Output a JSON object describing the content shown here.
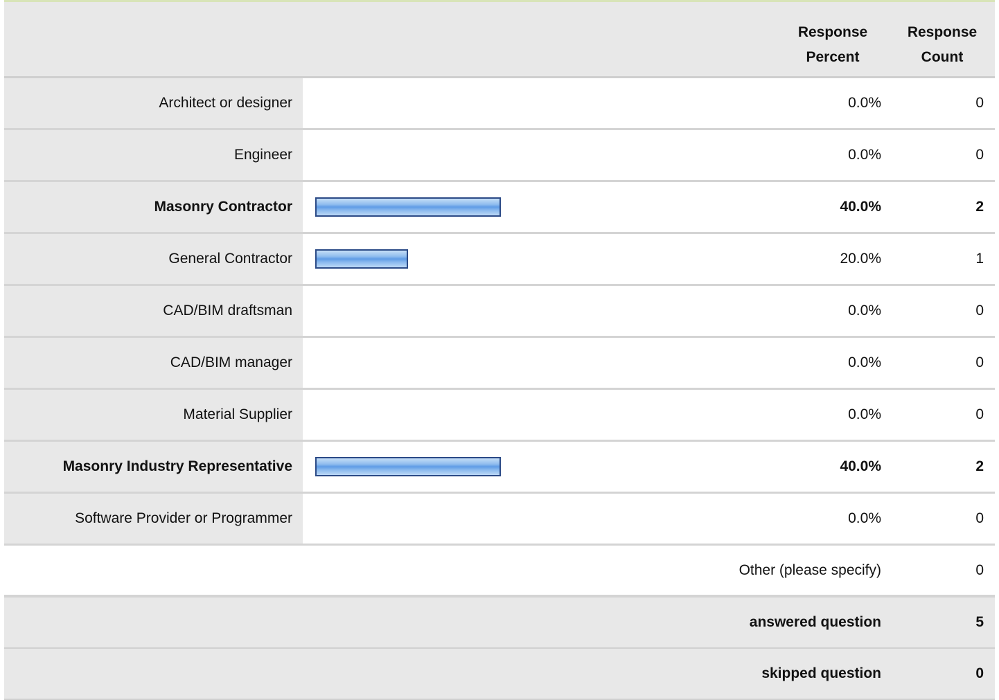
{
  "header": {
    "response_percent_line1": "Response",
    "response_percent_line2": "Percent",
    "response_count_line1": "Response",
    "response_count_line2": "Count"
  },
  "chart_data": {
    "type": "bar",
    "categories": [
      "Architect or designer",
      "Engineer",
      "Masonry Contractor",
      "General Contractor",
      "CAD/BIM draftsman",
      "CAD/BIM manager",
      "Material Supplier",
      "Masonry Industry Representative",
      "Software Provider or Programmer"
    ],
    "values": [
      0.0,
      0.0,
      40.0,
      20.0,
      0.0,
      0.0,
      0.0,
      40.0,
      0.0
    ],
    "percent_labels": [
      "0.0%",
      "0.0%",
      "40.0%",
      "20.0%",
      "0.0%",
      "0.0%",
      "0.0%",
      "40.0%",
      "0.0%"
    ],
    "counts": [
      "0",
      "0",
      "2",
      "1",
      "0",
      "0",
      "0",
      "2",
      "0"
    ],
    "bold": [
      false,
      false,
      true,
      false,
      false,
      false,
      false,
      true,
      false
    ],
    "ylim": [
      0,
      100
    ]
  },
  "other": {
    "label": "Other (please specify)",
    "count": "0"
  },
  "summary": {
    "answered_label": "answered question",
    "answered_count": "5",
    "skipped_label": "skipped question",
    "skipped_count": "0"
  },
  "colors": {
    "bar_border": "#2b4a86",
    "bar_fill": "#5f9ce6",
    "label_bg": "#e8e8e8"
  }
}
